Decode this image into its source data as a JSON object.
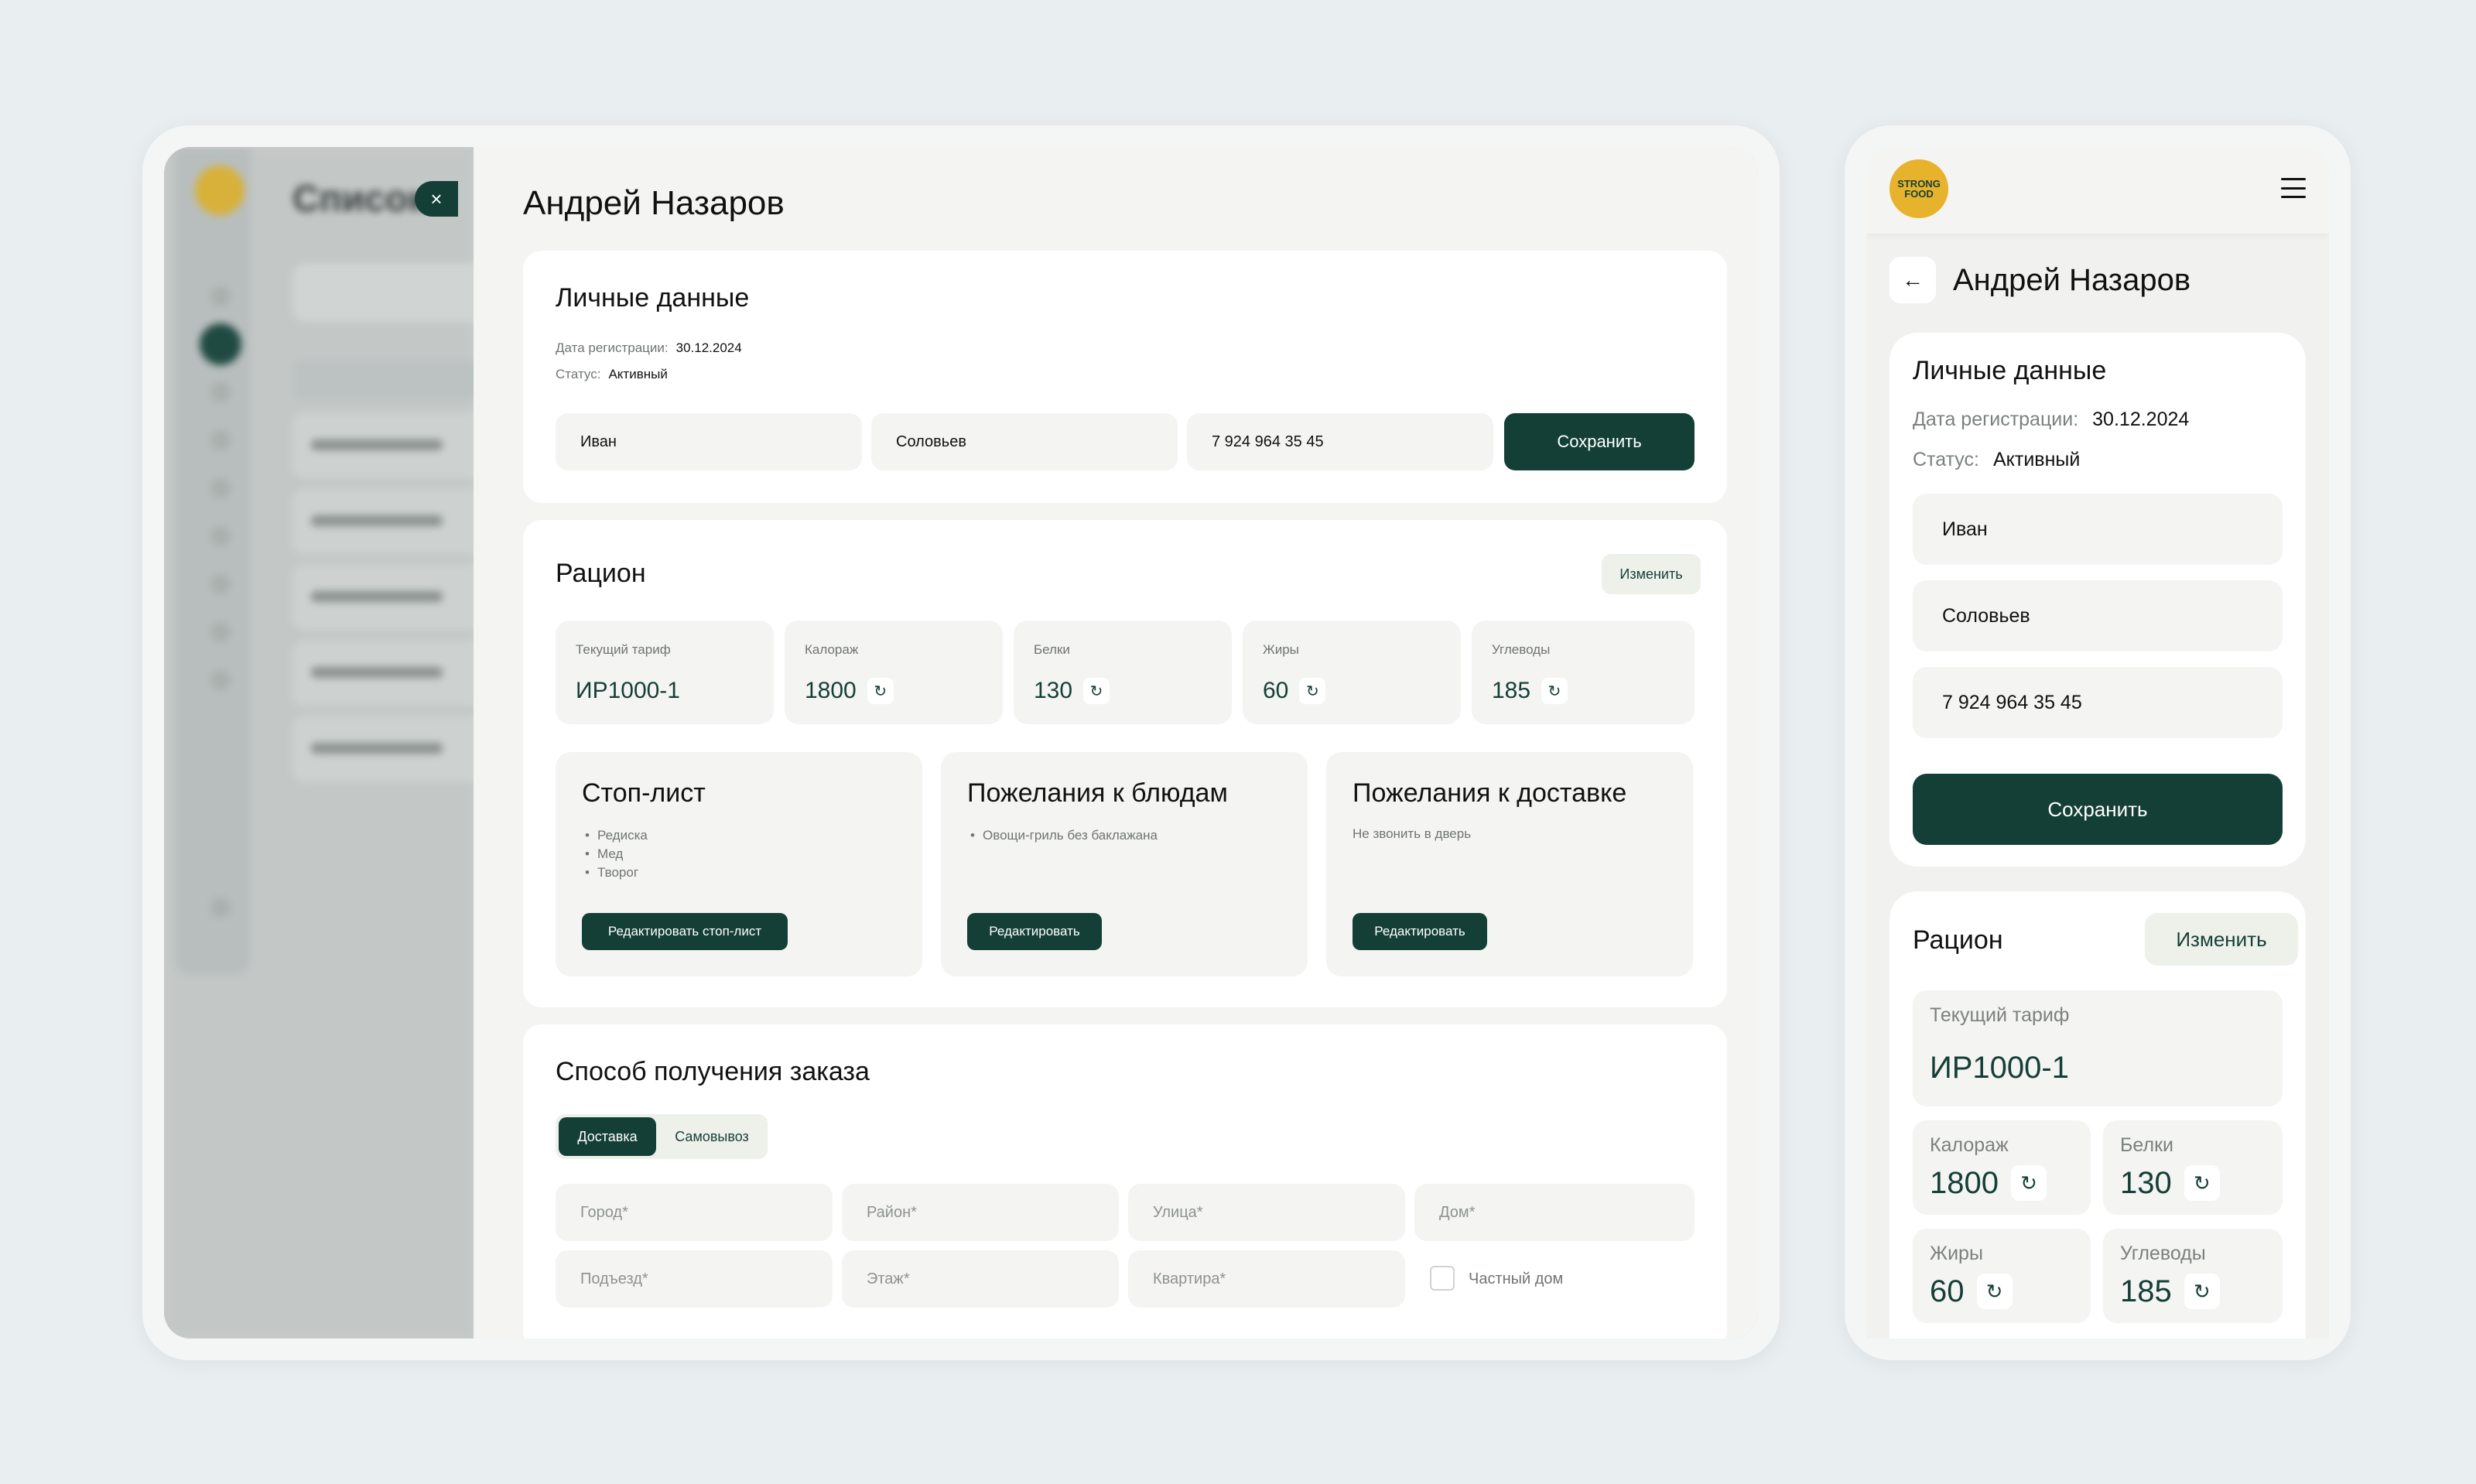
{
  "background_app": {
    "title": "Список"
  },
  "drawer": {
    "close_icon": "×",
    "title": "Андрей Назаров",
    "personal": {
      "title": "Личные данные",
      "reg_label": "Дата регистрации:",
      "reg_value": "30.12.2024",
      "status_label": "Статус:",
      "status_value": "Активный",
      "first_name": "Иван",
      "last_name": "Соловьев",
      "phone": "7 924 964 35 45",
      "save_label": "Сохранить"
    },
    "diet": {
      "title": "Рацион",
      "edit_label": "Изменить",
      "tiles": [
        {
          "label": "Текущий тариф",
          "value": "ИР1000-1"
        },
        {
          "label": "Калораж",
          "value": "1800"
        },
        {
          "label": "Белки",
          "value": "130"
        },
        {
          "label": "Жиры",
          "value": "60"
        },
        {
          "label": "Углеводы",
          "value": "185"
        }
      ],
      "stop_list": {
        "title": "Стоп-лист",
        "items": [
          "Редиска",
          "Мед",
          "Творог"
        ],
        "button": "Редактировать стоп-лист"
      },
      "dish_wishes": {
        "title": "Пожелания к блюдам",
        "items": [
          "Овощи-гриль без баклажана"
        ],
        "button": "Редактировать"
      },
      "delivery_wishes": {
        "title": "Пожелания к доставке",
        "text": "Не звонить в дверь",
        "button": "Редактировать"
      }
    },
    "receipt": {
      "title": "Способ получения заказа",
      "tabs": [
        "Доставка",
        "Самовывоз"
      ],
      "fields": {
        "city": "Город*",
        "district": "Район*",
        "street": "Улица*",
        "house": "Дом*",
        "entrance": "Подъезд*",
        "floor": "Этаж*",
        "apartment": "Квартира*"
      },
      "private_house_label": "Частный дом"
    }
  },
  "mobile": {
    "logo_line1": "STRONG",
    "logo_line2": "FOOD",
    "back_icon": "←",
    "title": "Андрей Назаров",
    "personal": {
      "title": "Личные данные",
      "reg_label": "Дата регистрации:",
      "reg_value": "30.12.2024",
      "status_label": "Статус:",
      "status_value": "Активный",
      "first_name": "Иван",
      "last_name": "Соловьев",
      "phone": "7 924 964 35 45",
      "save_label": "Сохранить"
    },
    "diet": {
      "title": "Рацион",
      "edit_label": "Изменить",
      "tariff_label": "Текущий тариф",
      "tariff_value": "ИР1000-1",
      "tiles": [
        {
          "label": "Калораж",
          "value": "1800"
        },
        {
          "label": "Белки",
          "value": "130"
        },
        {
          "label": "Жиры",
          "value": "60"
        },
        {
          "label": "Углеводы",
          "value": "185"
        }
      ]
    }
  },
  "icons": {
    "refresh": "↻"
  },
  "colors": {
    "accent": "#143f37",
    "logo": "#e7b22c"
  }
}
